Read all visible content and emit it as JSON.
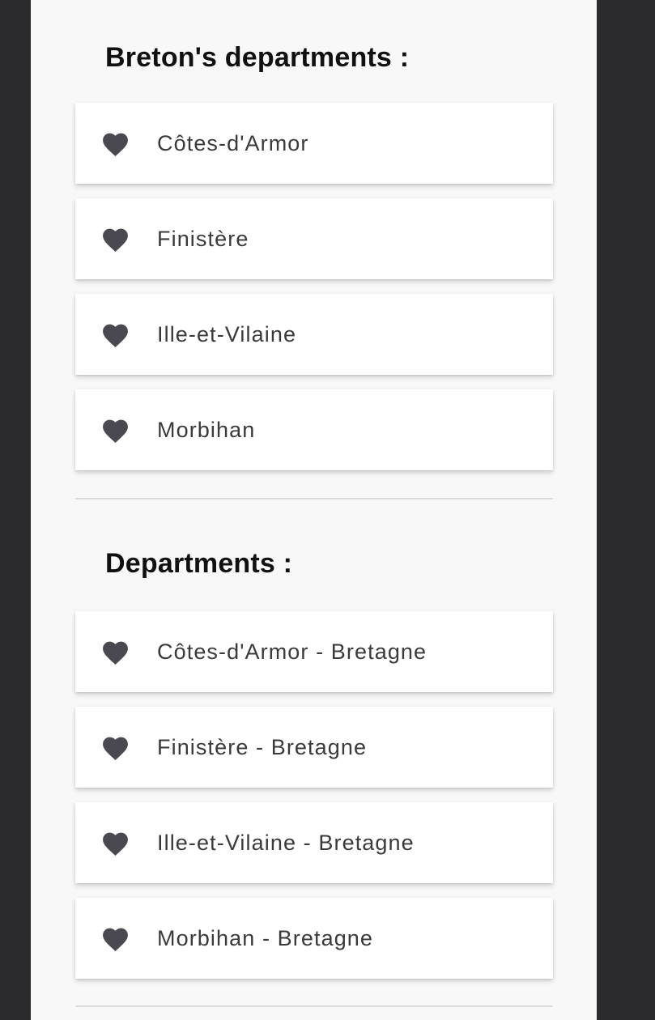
{
  "sections": [
    {
      "title": "Breton's departments :",
      "items": [
        {
          "label": "Côtes-d'Armor",
          "icon": "heart-icon"
        },
        {
          "label": "Finistère",
          "icon": "heart-icon"
        },
        {
          "label": "Ille-et-Vilaine",
          "icon": "heart-icon"
        },
        {
          "label": "Morbihan",
          "icon": "heart-icon"
        }
      ]
    },
    {
      "title": "Departments :",
      "items": [
        {
          "label": "Côtes-d'Armor - Bretagne",
          "icon": "heart-icon"
        },
        {
          "label": "Finistère - Bretagne",
          "icon": "heart-icon"
        },
        {
          "label": "Ille-et-Vilaine - Bretagne",
          "icon": "heart-icon"
        },
        {
          "label": "Morbihan - Bretagne",
          "icon": "heart-icon"
        }
      ]
    }
  ],
  "colors": {
    "background": "#2b2a2d",
    "screen": "#f7f8f7",
    "card": "#ffffff",
    "heart": "#4a4850",
    "text": "#3a3a3d",
    "divider": "#d9dcdc"
  }
}
